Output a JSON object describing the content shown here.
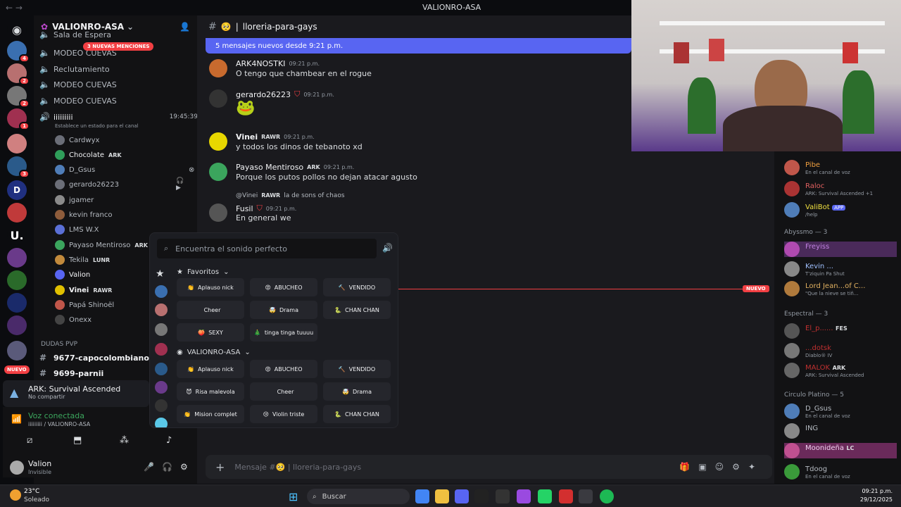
{
  "window": {
    "title": "VALIONRO-ASA",
    "nav_back": "←",
    "nav_fwd": "→"
  },
  "rail": {
    "badges": [
      "4",
      "2",
      "2",
      "1",
      "3"
    ],
    "new_label": "NUEVO"
  },
  "server": {
    "name": "VALIONRO-ASA",
    "mentions": "3 NUEVAS MENCIONES"
  },
  "channels": [
    {
      "name": "Sala de Espera"
    },
    {
      "name": "MODEO CUEVAS"
    },
    {
      "name": "Reclutamiento"
    },
    {
      "name": "MODEO CUEVAS"
    },
    {
      "name": "MODEO CUEVAS"
    }
  ],
  "voice_channel": {
    "name": "iiiiiiiii",
    "timer": "19:45:39",
    "status_hint": "Establece un estado para el canal"
  },
  "voice_users": [
    {
      "name": "Cardwyx",
      "tag": "",
      "color": "#6b6e78"
    },
    {
      "name": "Chocolate",
      "tag": "ARK",
      "color": "#2f9e5a"
    },
    {
      "name": "D_Gsus",
      "tag": "",
      "color": "#4f7db8"
    },
    {
      "name": "gerardo26223",
      "tag": "",
      "color": "#6b6e78"
    },
    {
      "name": "jgamer",
      "tag": "",
      "color": "#8a8a8a"
    },
    {
      "name": "kevin franco",
      "tag": "",
      "color": "#8e5c3b"
    },
    {
      "name": "LMS W.X",
      "tag": "",
      "color": "#5a6fd6"
    },
    {
      "name": "Payaso Mentiroso",
      "tag": "ARK",
      "color": "#3ba55d"
    },
    {
      "name": "Tekila",
      "tag": "LUNR",
      "color": "#c28a3c"
    },
    {
      "name": "Valion",
      "tag": "",
      "color": "#5865f2"
    },
    {
      "name": "Vinei",
      "tag": "RAWR",
      "color": "#e0c000"
    },
    {
      "name": "Papá Shinoёl",
      "tag": "",
      "color": "#c0564a"
    },
    {
      "name": "Onexx",
      "tag": "",
      "color": "#444"
    }
  ],
  "categories": {
    "dudas": "DUDAS PVP",
    "ch1": "9677-capocolombiano5",
    "ch2": "9699-parnii"
  },
  "activity": {
    "game": "ARK: Survival Ascended",
    "sub": "No compartir"
  },
  "voice": {
    "status": "Voz conectada",
    "path": "iiiiiiiii / VALIONRO-ASA"
  },
  "user": {
    "name": "Valion",
    "status": "Invisible"
  },
  "chat": {
    "channel": "lloreria-para-gays",
    "new_messages": "5 mensajes nuevos desde 9:21 p.m.",
    "new_line": "NUEVO",
    "composer": "Mensaje #🥺 | lloreria-para-gays",
    "messages": [
      {
        "author": "ARK4NOSTKI",
        "time": "09:21 p.m.",
        "text": "O tengo que chambear en el rogue",
        "color": "#c86a2e"
      },
      {
        "author": "gerardo26223",
        "time": "09:21 p.m.",
        "text": "",
        "color": "#333"
      },
      {
        "author": "Vinei",
        "tag": "RAWR",
        "time": "09:21 p.m.",
        "text": "y todos los dinos de tebanoto xd",
        "color": "#e8d700"
      },
      {
        "author": "Payaso Mentiroso",
        "tag": "ARK",
        "time": "09:21 p.m.",
        "text": "Porque los putos pollos no dejan atacar agusto",
        "color": "#3ba55d"
      },
      {
        "author": "Fusil",
        "time": "09:21 p.m.",
        "text": "En general we",
        "color": "#555",
        "reply_name": "@Vinei",
        "reply_tag": "RAWR",
        "reply_text": "la de sons of chaos"
      }
    ]
  },
  "soundboard": {
    "search_placeholder": "Encuentra el sonido perfecto",
    "favorites_label": "Favoritos",
    "server_label": "VALIONRO-ASA",
    "favorites": [
      {
        "label": "Aplauso nick",
        "icon": "👏"
      },
      {
        "label": "ABUCHEO",
        "icon": "😡"
      },
      {
        "label": "VENDIDO",
        "icon": "🔨"
      },
      {
        "label": "Cheer",
        "icon": ""
      },
      {
        "label": "Drama",
        "icon": "🤯"
      },
      {
        "label": "CHAN CHAN",
        "icon": "🐍"
      },
      {
        "label": "SEXY",
        "icon": "🍑"
      },
      {
        "label": "tinga tinga tuuuu",
        "icon": "🎄"
      }
    ],
    "server_sounds": [
      {
        "label": "Aplauso nick",
        "icon": "👏"
      },
      {
        "label": "ABUCHEO",
        "icon": "😡"
      },
      {
        "label": "VENDIDO",
        "icon": "🔨"
      },
      {
        "label": "Risa malevola",
        "icon": "😈"
      },
      {
        "label": "Cheer",
        "icon": ""
      },
      {
        "label": "Drama",
        "icon": "🤯"
      },
      {
        "label": "Mision complet",
        "icon": "👏"
      },
      {
        "label": "Violin triste",
        "icon": "😢"
      },
      {
        "label": "CHAN CHAN",
        "icon": "🐍"
      }
    ]
  },
  "members": {
    "top": [
      {
        "name": "Pibe",
        "status": "En el canal de voz",
        "color": "#c0564a"
      },
      {
        "name": "Raloc",
        "status": "ARK: Survival Ascended +1",
        "color": "#a33"
      },
      {
        "name": "ValiBot",
        "status": "/help",
        "app": "APP",
        "color": "#4f7db8"
      }
    ],
    "group1": "Abyssmo — 3",
    "g1": [
      {
        "name": "Freyiss",
        "status": "",
        "color": "#b04ab0"
      },
      {
        "name": "Kevin ...",
        "status": "T'ziquin Pa Shut",
        "color": "#888"
      },
      {
        "name": "Lord Jean...of C...",
        "status": "\"Que la nieve se tiñ...",
        "color": "#b07a3c"
      }
    ],
    "group2": "Espectral — 3",
    "g2": [
      {
        "name": "El_p......",
        "status": "",
        "tag": "FES",
        "color": "#555"
      },
      {
        "name": "...dotsk",
        "status": "Diablo® IV",
        "color": "#777"
      },
      {
        "name": "MALOK",
        "status": "ARK: Survival Ascended",
        "tag": "ARK",
        "color": "#666"
      }
    ],
    "group3": "Circulo Platino — 5",
    "g3": [
      {
        "name": "D_Gsus",
        "status": "En el canal de voz",
        "color": "#4f7db8"
      },
      {
        "name": "ING",
        "status": "",
        "color": "#888"
      },
      {
        "name": "Moonideña",
        "status": "",
        "tag": "LC",
        "color": "#c05090"
      },
      {
        "name": "Tdoog",
        "status": "En el canal de voz",
        "color": "#3a9a3a"
      }
    ]
  },
  "taskbar": {
    "weather_temp": "23°C",
    "weather_text": "Soleado",
    "search": "Buscar",
    "time": "09:21 p.m.",
    "date": "29/12/2025"
  }
}
